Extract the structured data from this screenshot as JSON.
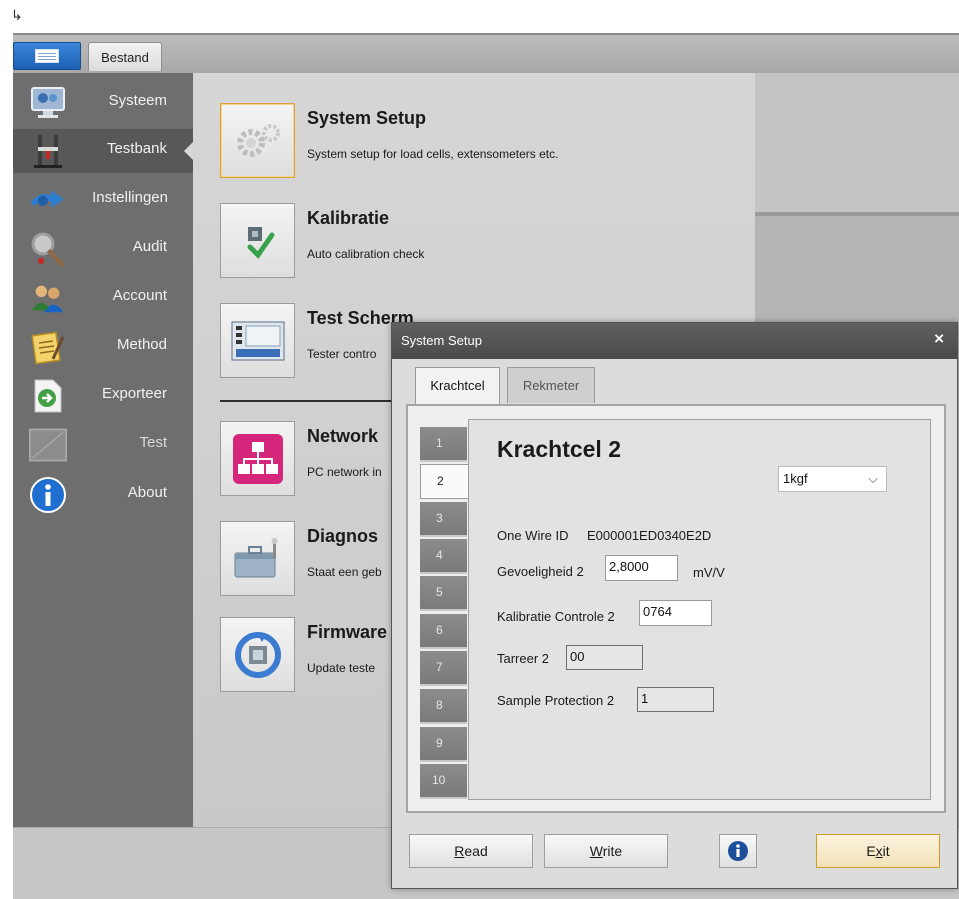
{
  "window": {
    "cursor_glyph": "↳"
  },
  "ribbon": {
    "app_button_icon": "app-menu-icon",
    "tab_label": "Bestand"
  },
  "sidebar": {
    "items": [
      {
        "label": "Systeem",
        "icon": "monitor-icon",
        "active": false
      },
      {
        "label": "Testbank",
        "icon": "test-bench-icon",
        "active": true
      },
      {
        "label": "Instellingen",
        "icon": "settings-arrows-icon",
        "active": false
      },
      {
        "label": "Audit",
        "icon": "magnifier-icon",
        "active": false
      },
      {
        "label": "Account",
        "icon": "users-icon",
        "active": false
      },
      {
        "label": "Method",
        "icon": "notepad-icon",
        "active": false
      },
      {
        "label": "Exporteer",
        "icon": "export-arrow-icon",
        "active": false
      },
      {
        "label": "Test",
        "icon": "chart-icon",
        "active": false
      },
      {
        "label": "About",
        "icon": "info-icon",
        "active": false
      }
    ]
  },
  "main": {
    "entries": [
      {
        "title": "System Setup",
        "desc": "System setup for load cells, extensometers etc.",
        "icon": "gears-icon"
      },
      {
        "title": "Kalibratie",
        "desc": "Auto calibration check",
        "icon": "calibration-check-icon"
      },
      {
        "title": "Test Scherm",
        "desc": "Tester contro",
        "icon": "tester-display-icon"
      },
      {
        "title": "Network",
        "desc": "PC network in",
        "icon": "network-icon"
      },
      {
        "title": "Diagnos",
        "desc": "Staat een geb",
        "icon": "toolbox-icon"
      },
      {
        "title": "Firmware",
        "desc": "Update teste",
        "icon": "firmware-update-icon"
      }
    ]
  },
  "dialog": {
    "title": "System Setup",
    "close": "×",
    "tabs": [
      {
        "label": "Krachtcel",
        "active": true
      },
      {
        "label": "Rekmeter",
        "active": false
      }
    ],
    "side_tabs": [
      "1",
      "2",
      "3",
      "4",
      "5",
      "6",
      "7",
      "8",
      "9",
      "10"
    ],
    "active_side_tab": "2",
    "panel": {
      "heading": "Krachtcel 2",
      "range_value": "1kgf",
      "one_wire_label": "One Wire ID",
      "one_wire_value": "E000001ED0340E2D",
      "gevoeligheid_label": "Gevoeligheid 2",
      "gevoeligheid_value": "2,8000",
      "gevoeligheid_unit": "mV/V",
      "kalibratie_label": "Kalibratie Controle 2",
      "kalibratie_value": "0764",
      "tarreer_label": "Tarreer 2",
      "tarreer_value": "00",
      "sample_label": "Sample Protection 2",
      "sample_value": "1"
    },
    "buttons": {
      "read_rest": "ead",
      "write_rest": "rite",
      "exit_first": "E",
      "exit_rest": "it",
      "read_key": "R",
      "write_key": "W",
      "exit_key": "x"
    }
  }
}
